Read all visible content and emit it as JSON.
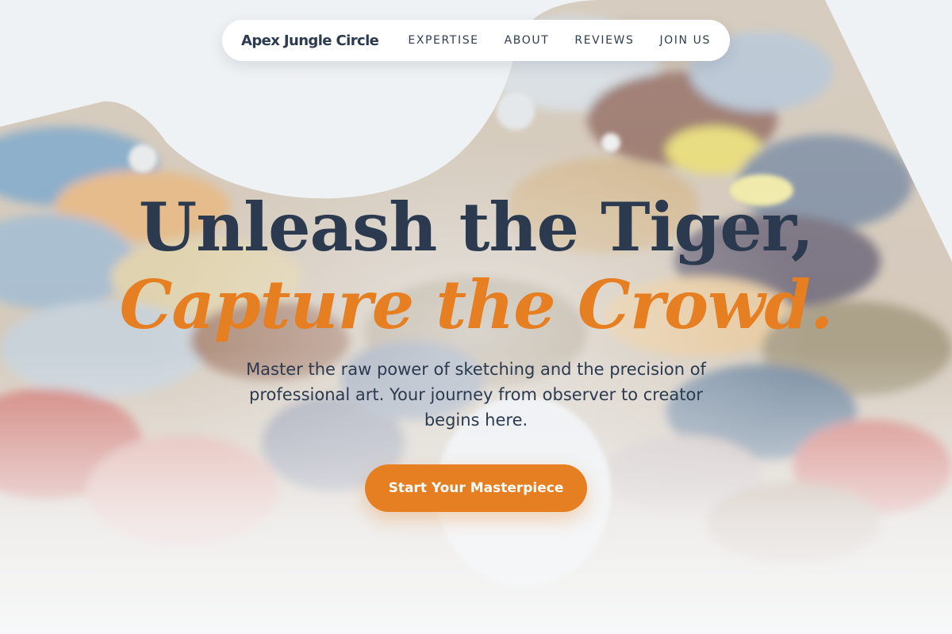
{
  "nav": {
    "brand": "Apex Jungle Circle",
    "links": [
      "EXPERTISE",
      "ABOUT",
      "REVIEWS",
      "JOIN US"
    ]
  },
  "hero": {
    "headline_line1": "Unleash the Tiger,",
    "headline_line2": "Capture the Crowd.",
    "subtitle": "Master the raw power of sketching and the precision of professional art. Your journey from observer to creator begins here.",
    "cta_label": "Start Your Masterpiece"
  },
  "colors": {
    "accent": "#e67e22",
    "heading": "#2b3a4f",
    "nav_background": "#ffffff",
    "page_background": "#eef1f3"
  },
  "background_image": "paint-palette"
}
